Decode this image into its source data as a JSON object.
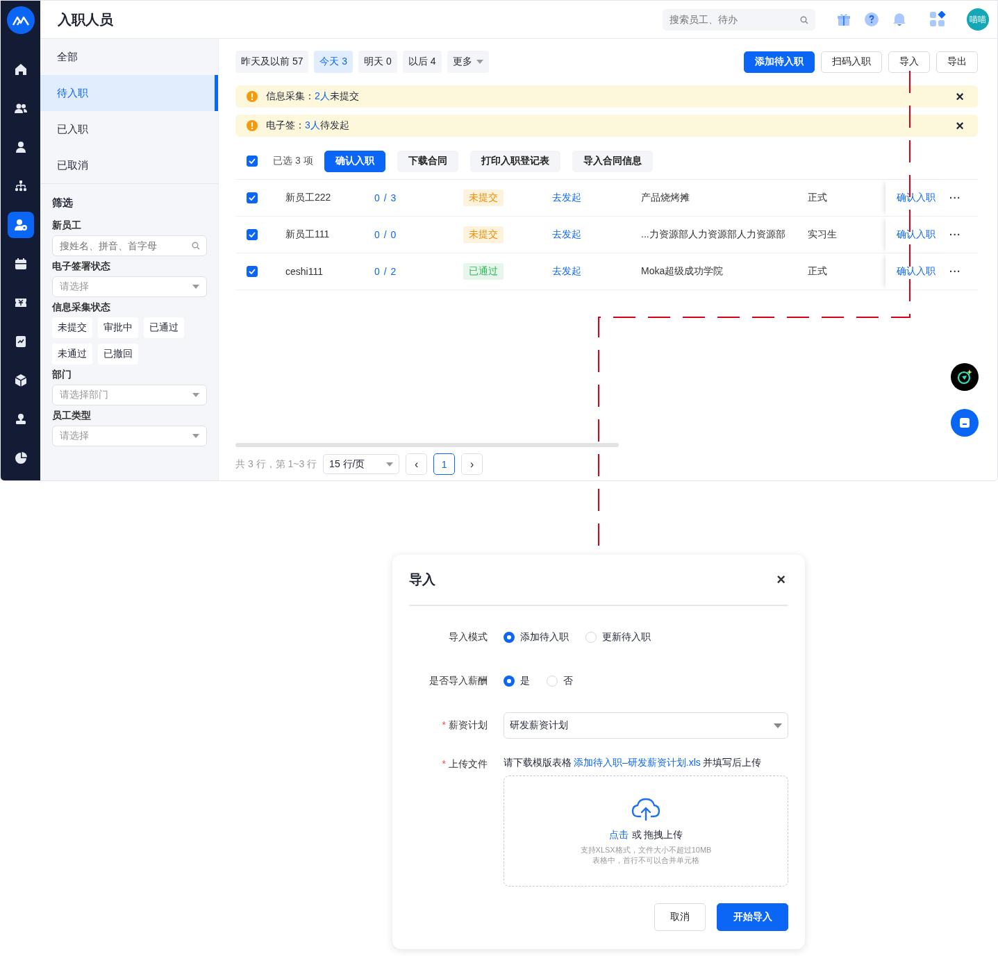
{
  "rail": {
    "items": [
      {
        "selected": false
      },
      {
        "selected": false
      },
      {
        "selected": false
      },
      {
        "selected": false
      },
      {
        "selected": true
      },
      {
        "selected": false
      },
      {
        "selected": false
      },
      {
        "selected": false
      },
      {
        "selected": false
      },
      {
        "selected": false
      },
      {
        "selected": false
      }
    ]
  },
  "header": {
    "title": "入职人员",
    "search": {
      "placeholder": "搜索员工、待办"
    },
    "avatar": "喵喵"
  },
  "sidebar": {
    "items": [
      {
        "label": "全部",
        "selected": false
      },
      {
        "label": "待入职",
        "selected": true
      },
      {
        "label": "已入职",
        "selected": false
      },
      {
        "label": "已取消",
        "selected": false
      }
    ],
    "filter_title": "筛选",
    "filters": [
      {
        "kind": "search",
        "label": "新员工",
        "placeholder": "搜姓名、拼音、首字母"
      },
      {
        "kind": "select",
        "label": "电子签署状态",
        "placeholder": "请选择"
      },
      {
        "kind": "chips",
        "label": "信息采集状态",
        "chips": [
          "未提交",
          "审批中",
          "已通过",
          "未通过",
          "已撤回"
        ]
      },
      {
        "kind": "select",
        "label": "部门",
        "placeholder": "请选择部门"
      },
      {
        "kind": "select",
        "label": "员工类型",
        "placeholder": "请选择"
      }
    ]
  },
  "date_tabs": [
    {
      "label": "昨天及以前 57",
      "selected": false
    },
    {
      "label": "今天 3",
      "selected": true
    },
    {
      "label": "明天 0",
      "selected": false
    },
    {
      "label": "以后 4",
      "selected": false
    }
  ],
  "more_tab": "更多",
  "actions": [
    {
      "label": "添加待入职",
      "kind": "primary"
    },
    {
      "label": "扫码入职",
      "kind": "default"
    },
    {
      "label": "导入",
      "kind": "default"
    },
    {
      "label": "导出",
      "kind": "default"
    }
  ],
  "alerts": [
    {
      "label": "信息采集：",
      "count": "2人",
      "text": "未提交",
      "close": "×"
    },
    {
      "label": "电子签：",
      "count": "3人",
      "text": "待发起",
      "close": "×"
    }
  ],
  "bulk": {
    "checked": true,
    "selected_text": "已选 3 项",
    "buttons": [
      {
        "label": "确认入职",
        "kind": "primary"
      },
      {
        "label": "下载合同",
        "kind": "default"
      },
      {
        "label": "打印入职登记表",
        "kind": "default"
      },
      {
        "label": "导入合同信息",
        "kind": "default"
      }
    ]
  },
  "table": {
    "rows": [
      {
        "checked": true,
        "name": "新员工222",
        "progress": "0 / 3",
        "status": {
          "label": "未提交",
          "kind": "pending"
        },
        "sign": "去发起",
        "dept": "产品烧烤摊",
        "type": "正式",
        "action": "确认入职",
        "more": "···"
      },
      {
        "checked": true,
        "name": "新员工111",
        "progress": "0 / 0",
        "status": {
          "label": "未提交",
          "kind": "pending"
        },
        "sign": "去发起",
        "dept": "...力资源部人力资源部人力资源部",
        "type": "实习生",
        "action": "确认入职",
        "more": "···"
      },
      {
        "checked": true,
        "name": "ceshi111",
        "progress": "0 / 2",
        "status": {
          "label": "已通过",
          "kind": "passed"
        },
        "sign": "去发起",
        "dept": "Moka超级成功学院",
        "type": "正式",
        "action": "确认入职",
        "more": "···"
      }
    ]
  },
  "pagination": {
    "summary": "共 3 行，第 1~3 行",
    "page_size": "15 行/页",
    "prev": "‹",
    "pages": [
      {
        "label": "1",
        "selected": true
      }
    ],
    "next": "›"
  },
  "dialog": {
    "title": "导入",
    "close": "×",
    "mode": {
      "label": "导入模式",
      "options": [
        {
          "label": "添加待入职",
          "selected": true
        },
        {
          "label": "更新待入职",
          "selected": false
        }
      ]
    },
    "salary": {
      "label": "是否导入薪酬",
      "options": [
        {
          "label": "是",
          "selected": true
        },
        {
          "label": "否",
          "selected": false
        }
      ]
    },
    "plan": {
      "label": "薪资计划",
      "required": true,
      "required_mark": "*",
      "value": "研发薪资计划"
    },
    "upload": {
      "label": "上传文件",
      "required": true,
      "required_mark": "*",
      "hint_before": "请下载模版表格",
      "link": "添加待入职–研发薪资计划.xls",
      "hint_after": "并填写后上传",
      "click": "点击",
      "drag": "或 拖拽上传",
      "notes": [
        "支持XLSX格式，文件大小不超过10MB",
        "表格中，首行不可以合并单元格"
      ]
    },
    "buttons": [
      {
        "label": "取消",
        "kind": "default"
      },
      {
        "label": "开始导入",
        "kind": "primary"
      }
    ]
  }
}
